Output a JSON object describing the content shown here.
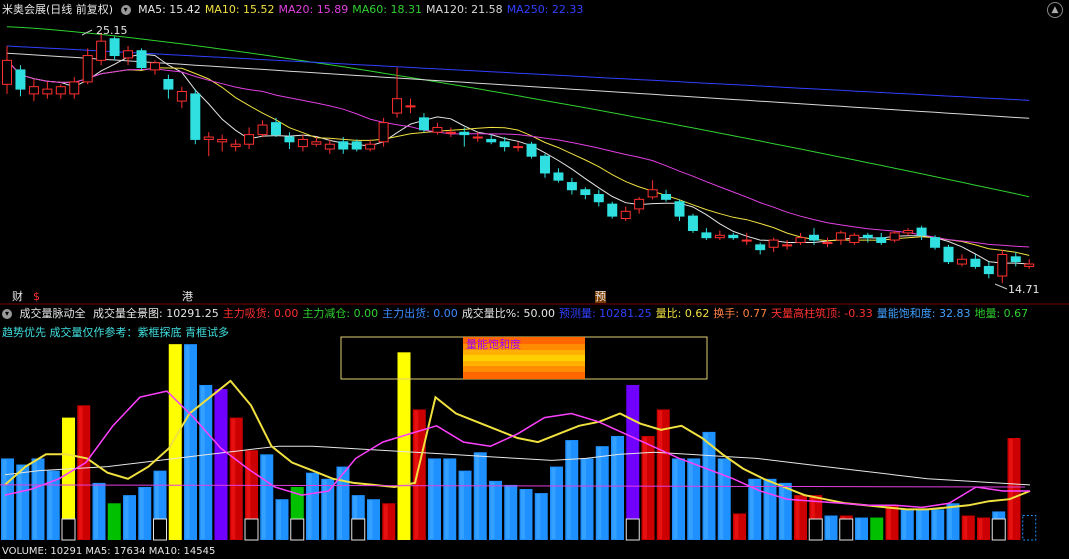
{
  "window": {
    "title": "米奥会展(日线 前复权)",
    "ma_indicators": [
      {
        "label": "MA5: 15.42",
        "color": "#e6e6e6"
      },
      {
        "label": "MA10: 15.52",
        "color": "#f0e040"
      },
      {
        "label": "MA20: 15.89",
        "color": "#e040e0"
      },
      {
        "label": "MA60: 18.31",
        "color": "#30d030"
      },
      {
        "label": "MA120: 21.58",
        "color": "#d8d8d8"
      },
      {
        "label": "MA250: 22.33",
        "color": "#3040ff"
      }
    ],
    "high_label": "25.15",
    "low_label": "14.71",
    "markers": [
      "财",
      "$",
      "港",
      "预"
    ]
  },
  "subpanel": {
    "title": "成交量脉动全",
    "indicators": [
      {
        "label": "成交量全景图: 10291.25",
        "color": "#e6e6e6"
      },
      {
        "label": "主力吸货: 0.00",
        "color": "#ff3030"
      },
      {
        "label": "主力减仓: 0.00",
        "color": "#30d030"
      },
      {
        "label": "主力出货: 0.00",
        "color": "#3a8cff"
      },
      {
        "label": "成交量比%: 50.00",
        "color": "#e6e6e6"
      },
      {
        "label": "预测量: 10281.25",
        "color": "#3040ff"
      },
      {
        "label": "量比: 0.62",
        "color": "#f0e040"
      },
      {
        "label": "换手: 0.77",
        "color": "#ff8040"
      },
      {
        "label": "天量高柱筑顶: -0.33",
        "color": "#ff3030"
      },
      {
        "label": "量能饱和度: 32.83",
        "color": "#40a0ff"
      },
      {
        "label": "地量: 0.67",
        "color": "#30d030"
      }
    ],
    "note": "趋势优先 成交量仅作参考：紫框探底 青框试多",
    "saturation_label": "量能饱和度",
    "volume_footer": "VOLUME: 10291   MA5: 17634   MA10: 14545"
  },
  "colors": {
    "up": "#ff3030",
    "down": "#30e0e0",
    "volume_blue": "#1e90ff"
  },
  "chart_data": {
    "type": "candlestick",
    "price_range": [
      14.71,
      25.15
    ],
    "candles": [
      {
        "o": 23.0,
        "c": 24.0,
        "h": 24.6,
        "l": 22.6
      },
      {
        "o": 23.6,
        "c": 22.8,
        "h": 23.8,
        "l": 22.5
      },
      {
        "o": 22.6,
        "c": 22.9,
        "h": 23.2,
        "l": 22.3
      },
      {
        "o": 22.6,
        "c": 22.8,
        "h": 23.1,
        "l": 22.4
      },
      {
        "o": 22.6,
        "c": 22.9,
        "h": 23.0,
        "l": 22.4
      },
      {
        "o": 22.6,
        "c": 23.1,
        "h": 23.3,
        "l": 22.4
      },
      {
        "o": 23.1,
        "c": 24.2,
        "h": 24.5,
        "l": 23.0
      },
      {
        "o": 24.0,
        "c": 24.8,
        "h": 25.15,
        "l": 23.8
      },
      {
        "o": 24.9,
        "c": 24.2,
        "h": 25.0,
        "l": 24.0
      },
      {
        "o": 24.1,
        "c": 24.4,
        "h": 24.6,
        "l": 23.8
      },
      {
        "o": 24.4,
        "c": 23.7,
        "h": 24.5,
        "l": 23.6
      },
      {
        "o": 23.6,
        "c": 23.9,
        "h": 24.0,
        "l": 23.4
      },
      {
        "o": 23.2,
        "c": 22.8,
        "h": 23.4,
        "l": 22.4
      },
      {
        "o": 22.3,
        "c": 22.7,
        "h": 22.9,
        "l": 22.0
      },
      {
        "o": 22.6,
        "c": 20.7,
        "h": 22.8,
        "l": 20.5
      },
      {
        "o": 20.7,
        "c": 20.8,
        "h": 21.0,
        "l": 20.0
      },
      {
        "o": 20.6,
        "c": 20.7,
        "h": 20.9,
        "l": 20.2
      },
      {
        "o": 20.4,
        "c": 20.5,
        "h": 20.7,
        "l": 20.2
      },
      {
        "o": 20.5,
        "c": 20.9,
        "h": 21.2,
        "l": 20.3
      },
      {
        "o": 20.9,
        "c": 21.3,
        "h": 21.5,
        "l": 20.8
      },
      {
        "o": 21.4,
        "c": 20.9,
        "h": 21.6,
        "l": 20.8
      },
      {
        "o": 20.8,
        "c": 20.6,
        "h": 21.0,
        "l": 20.3
      },
      {
        "o": 20.4,
        "c": 20.7,
        "h": 20.9,
        "l": 20.2
      },
      {
        "o": 20.5,
        "c": 20.6,
        "h": 20.8,
        "l": 20.4
      },
      {
        "o": 20.3,
        "c": 20.5,
        "h": 20.7,
        "l": 20.1
      },
      {
        "o": 20.6,
        "c": 20.3,
        "h": 20.8,
        "l": 20.1
      },
      {
        "o": 20.6,
        "c": 20.3,
        "h": 20.7,
        "l": 20.2
      },
      {
        "o": 20.3,
        "c": 20.5,
        "h": 20.7,
        "l": 20.2
      },
      {
        "o": 20.6,
        "c": 21.4,
        "h": 21.6,
        "l": 20.4
      },
      {
        "o": 21.8,
        "c": 22.4,
        "h": 23.7,
        "l": 21.6
      },
      {
        "o": 22.1,
        "c": 22.1,
        "h": 22.4,
        "l": 21.8
      },
      {
        "o": 21.6,
        "c": 21.1,
        "h": 21.8,
        "l": 21.0
      },
      {
        "o": 21.0,
        "c": 21.2,
        "h": 21.4,
        "l": 20.9
      },
      {
        "o": 21.0,
        "c": 21.0,
        "h": 21.2,
        "l": 20.8
      },
      {
        "o": 21.0,
        "c": 20.9,
        "h": 21.2,
        "l": 20.4
      },
      {
        "o": 20.8,
        "c": 20.8,
        "h": 21.0,
        "l": 20.6
      },
      {
        "o": 20.7,
        "c": 20.6,
        "h": 20.9,
        "l": 20.5
      },
      {
        "o": 20.6,
        "c": 20.4,
        "h": 20.8,
        "l": 20.2
      },
      {
        "o": 20.4,
        "c": 20.4,
        "h": 20.6,
        "l": 20.2
      },
      {
        "o": 20.5,
        "c": 20.0,
        "h": 20.6,
        "l": 19.9
      },
      {
        "o": 20.0,
        "c": 19.3,
        "h": 20.1,
        "l": 19.1
      },
      {
        "o": 19.3,
        "c": 19.0,
        "h": 19.5,
        "l": 18.9
      },
      {
        "o": 18.9,
        "c": 18.6,
        "h": 19.1,
        "l": 18.4
      },
      {
        "o": 18.6,
        "c": 18.4,
        "h": 18.7,
        "l": 18.2
      },
      {
        "o": 18.4,
        "c": 18.1,
        "h": 18.6,
        "l": 17.9
      },
      {
        "o": 18.0,
        "c": 17.5,
        "h": 18.1,
        "l": 17.4
      },
      {
        "o": 17.4,
        "c": 17.7,
        "h": 17.9,
        "l": 17.3
      },
      {
        "o": 17.8,
        "c": 18.2,
        "h": 18.3,
        "l": 17.6
      },
      {
        "o": 18.3,
        "c": 18.6,
        "h": 19.0,
        "l": 18.2
      },
      {
        "o": 18.4,
        "c": 18.2,
        "h": 18.6,
        "l": 18.1
      },
      {
        "o": 18.1,
        "c": 17.5,
        "h": 18.2,
        "l": 17.3
      },
      {
        "o": 17.5,
        "c": 16.9,
        "h": 17.6,
        "l": 16.8
      },
      {
        "o": 16.8,
        "c": 16.6,
        "h": 17.0,
        "l": 16.5
      },
      {
        "o": 16.6,
        "c": 16.7,
        "h": 16.9,
        "l": 16.5
      },
      {
        "o": 16.7,
        "c": 16.6,
        "h": 16.8,
        "l": 16.5
      },
      {
        "o": 16.5,
        "c": 16.5,
        "h": 16.8,
        "l": 16.3
      },
      {
        "o": 16.3,
        "c": 16.1,
        "h": 16.4,
        "l": 15.9
      },
      {
        "o": 16.2,
        "c": 16.5,
        "h": 16.6,
        "l": 16.0
      },
      {
        "o": 16.3,
        "c": 16.3,
        "h": 16.5,
        "l": 16.1
      },
      {
        "o": 16.4,
        "c": 16.6,
        "h": 16.8,
        "l": 16.3
      },
      {
        "o": 16.7,
        "c": 16.5,
        "h": 17.0,
        "l": 16.3
      },
      {
        "o": 16.4,
        "c": 16.4,
        "h": 16.6,
        "l": 16.2
      },
      {
        "o": 16.5,
        "c": 16.8,
        "h": 16.9,
        "l": 16.3
      },
      {
        "o": 16.4,
        "c": 16.7,
        "h": 16.8,
        "l": 16.3
      },
      {
        "o": 16.7,
        "c": 16.6,
        "h": 16.8,
        "l": 16.4
      },
      {
        "o": 16.6,
        "c": 16.4,
        "h": 16.8,
        "l": 16.3
      },
      {
        "o": 16.5,
        "c": 16.8,
        "h": 16.9,
        "l": 16.4
      },
      {
        "o": 16.8,
        "c": 16.9,
        "h": 17.0,
        "l": 16.7
      },
      {
        "o": 17.0,
        "c": 16.7,
        "h": 17.1,
        "l": 16.5
      },
      {
        "o": 16.6,
        "c": 16.2,
        "h": 16.7,
        "l": 16.1
      },
      {
        "o": 16.2,
        "c": 15.6,
        "h": 16.3,
        "l": 15.5
      },
      {
        "o": 15.5,
        "c": 15.7,
        "h": 15.9,
        "l": 15.4
      },
      {
        "o": 15.7,
        "c": 15.4,
        "h": 15.9,
        "l": 15.3
      },
      {
        "o": 15.4,
        "c": 15.1,
        "h": 15.6,
        "l": 14.9
      },
      {
        "o": 15.0,
        "c": 15.9,
        "h": 16.1,
        "l": 14.71
      },
      {
        "o": 15.8,
        "c": 15.6,
        "h": 16.0,
        "l": 15.4
      },
      {
        "o": 15.4,
        "c": 15.5,
        "h": 15.7,
        "l": 15.3
      }
    ],
    "volume": [
      {
        "v": 0.4,
        "c": "b"
      },
      {
        "v": 0.37,
        "c": "b"
      },
      {
        "v": 0.4,
        "c": "b"
      },
      {
        "v": 0.34,
        "c": "b"
      },
      {
        "v": 0.6,
        "c": "y"
      },
      {
        "v": 0.66,
        "c": "r"
      },
      {
        "v": 0.28,
        "c": "b"
      },
      {
        "v": 0.18,
        "c": "g"
      },
      {
        "v": 0.22,
        "c": "b"
      },
      {
        "v": 0.26,
        "c": "b"
      },
      {
        "v": 0.34,
        "c": "b"
      },
      {
        "v": 0.96,
        "c": "y"
      },
      {
        "v": 0.96,
        "c": "b"
      },
      {
        "v": 0.76,
        "c": "b"
      },
      {
        "v": 0.74,
        "c": "p"
      },
      {
        "v": 0.6,
        "c": "r"
      },
      {
        "v": 0.44,
        "c": "r"
      },
      {
        "v": 0.42,
        "c": "b"
      },
      {
        "v": 0.2,
        "c": "b"
      },
      {
        "v": 0.26,
        "c": "g"
      },
      {
        "v": 0.33,
        "c": "b"
      },
      {
        "v": 0.3,
        "c": "b"
      },
      {
        "v": 0.36,
        "c": "b"
      },
      {
        "v": 0.22,
        "c": "b"
      },
      {
        "v": 0.2,
        "c": "b"
      },
      {
        "v": 0.18,
        "c": "r"
      },
      {
        "v": 0.92,
        "c": "y"
      },
      {
        "v": 0.64,
        "c": "r"
      },
      {
        "v": 0.4,
        "c": "b"
      },
      {
        "v": 0.4,
        "c": "b"
      },
      {
        "v": 0.34,
        "c": "b"
      },
      {
        "v": 0.43,
        "c": "b"
      },
      {
        "v": 0.29,
        "c": "b"
      },
      {
        "v": 0.27,
        "c": "b"
      },
      {
        "v": 0.25,
        "c": "b"
      },
      {
        "v": 0.23,
        "c": "b"
      },
      {
        "v": 0.36,
        "c": "b"
      },
      {
        "v": 0.49,
        "c": "b"
      },
      {
        "v": 0.4,
        "c": "b"
      },
      {
        "v": 0.46,
        "c": "b"
      },
      {
        "v": 0.51,
        "c": "b"
      },
      {
        "v": 0.76,
        "c": "p"
      },
      {
        "v": 0.51,
        "c": "r"
      },
      {
        "v": 0.64,
        "c": "r"
      },
      {
        "v": 0.4,
        "c": "b"
      },
      {
        "v": 0.4,
        "c": "b"
      },
      {
        "v": 0.53,
        "c": "b"
      },
      {
        "v": 0.4,
        "c": "b"
      },
      {
        "v": 0.13,
        "c": "r"
      },
      {
        "v": 0.3,
        "c": "b"
      },
      {
        "v": 0.3,
        "c": "b"
      },
      {
        "v": 0.28,
        "c": "b"
      },
      {
        "v": 0.22,
        "c": "r"
      },
      {
        "v": 0.22,
        "c": "r"
      },
      {
        "v": 0.12,
        "c": "b"
      },
      {
        "v": 0.12,
        "c": "r"
      },
      {
        "v": 0.11,
        "c": "b"
      },
      {
        "v": 0.11,
        "c": "g"
      },
      {
        "v": 0.17,
        "c": "r"
      },
      {
        "v": 0.15,
        "c": "b"
      },
      {
        "v": 0.15,
        "c": "b"
      },
      {
        "v": 0.15,
        "c": "b"
      },
      {
        "v": 0.18,
        "c": "b"
      },
      {
        "v": 0.12,
        "c": "r"
      },
      {
        "v": 0.11,
        "c": "r"
      },
      {
        "v": 0.14,
        "c": "b"
      },
      {
        "v": 0.5,
        "c": "r"
      },
      {
        "v": 0.12,
        "c": "o"
      }
    ],
    "volume_line_yellow": [
      0.27,
      0.36,
      0.42,
      0.42,
      0.4,
      0.33,
      0.3,
      0.36,
      0.45,
      0.62,
      0.7,
      0.78,
      0.66,
      0.46,
      0.38,
      0.34,
      0.3,
      0.28,
      0.27,
      0.26,
      0.28,
      0.7,
      0.62,
      0.58,
      0.54,
      0.5,
      0.48,
      0.52,
      0.56,
      0.58,
      0.62,
      0.57,
      0.54,
      0.56,
      0.5,
      0.42,
      0.35,
      0.3,
      0.26,
      0.22,
      0.2,
      0.18,
      0.17,
      0.16,
      0.15,
      0.15,
      0.16,
      0.17,
      0.19,
      0.2,
      0.24
    ],
    "volume_line_white": [
      0.32,
      0.34,
      0.35,
      0.36,
      0.38,
      0.4,
      0.42,
      0.44,
      0.46,
      0.46,
      0.45,
      0.44,
      0.43,
      0.42,
      0.41,
      0.4,
      0.39,
      0.4,
      0.42,
      0.43,
      0.42,
      0.41,
      0.4,
      0.38,
      0.36,
      0.34,
      0.32,
      0.3,
      0.29,
      0.28,
      0.27
    ],
    "volume_line_magenta": [
      0.22,
      0.25,
      0.3,
      0.38,
      0.56,
      0.7,
      0.73,
      0.6,
      0.45,
      0.35,
      0.26,
      0.22,
      0.24,
      0.4,
      0.48,
      0.52,
      0.56,
      0.48,
      0.46,
      0.52,
      0.6,
      0.62,
      0.58,
      0.52,
      0.46,
      0.4,
      0.35,
      0.3,
      0.24,
      0.2,
      0.19,
      0.18,
      0.17,
      0.17,
      0.16,
      0.18,
      0.26,
      0.24,
      0.24
    ]
  }
}
